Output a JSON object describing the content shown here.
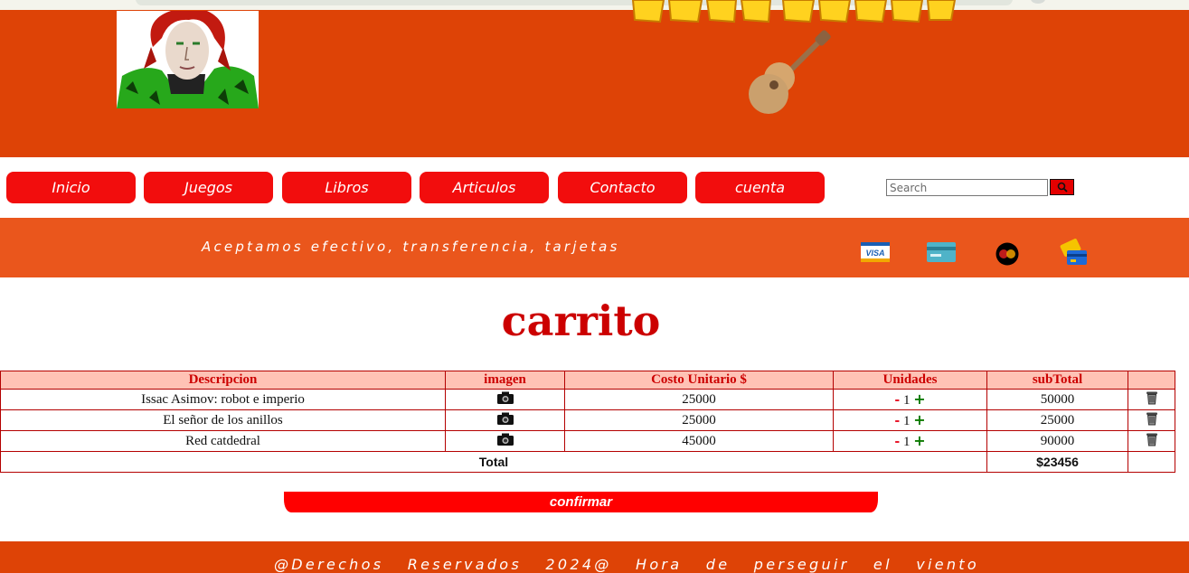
{
  "header": {
    "avatar_icon": "character-portrait-image",
    "logo_icon": "site-logo-wordmark",
    "guitar_icon": "guitar-icon",
    "colors": {
      "background": "#de4306",
      "logo": "#ffd21f"
    }
  },
  "nav": {
    "items": [
      {
        "label": "Inicio"
      },
      {
        "label": "Juegos"
      },
      {
        "label": "Libros"
      },
      {
        "label": "Articulos"
      },
      {
        "label": "Contacto"
      },
      {
        "label": "cuenta"
      }
    ],
    "search": {
      "placeholder": "Search",
      "button_icon": "search-icon"
    },
    "colors": {
      "button": "#f20d0d"
    }
  },
  "payments": {
    "text": "Aceptamos efectivo, transferencia, tarjetas",
    "icons": [
      "visa-card-icon",
      "credit-card-icon",
      "mastercard-icon",
      "card-payment-icon"
    ],
    "colors": {
      "background": "#ea561c"
    }
  },
  "cart": {
    "title": "carrito",
    "columns": [
      "Descripcion",
      "imagen",
      "Costo Unitario $",
      "Unidades",
      "subTotal",
      ""
    ],
    "rows": [
      {
        "description": "Issac Asimov: robot e imperio",
        "image_icon": "camera-icon",
        "unit_cost": "25000",
        "minus": "-",
        "qty": "1",
        "plus": "+",
        "subtotal": "50000",
        "delete_icon": "trash-icon"
      },
      {
        "description": "El señor de los anillos",
        "image_icon": "camera-icon",
        "unit_cost": "25000",
        "minus": "-",
        "qty": "1",
        "plus": "+",
        "subtotal": "25000",
        "delete_icon": "trash-icon"
      },
      {
        "description": "Red catdedral",
        "image_icon": "camera-icon",
        "unit_cost": "45000",
        "minus": "-",
        "qty": "1",
        "plus": "+",
        "subtotal": "90000",
        "delete_icon": "trash-icon"
      }
    ],
    "total_label": "Total",
    "total_value": "$23456",
    "confirm_label": "confirmar",
    "colors": {
      "accent": "#cc0000",
      "header_bg": "#ffc2b5",
      "total_bg": "#ffc8c0",
      "confirm": "#ff0000"
    }
  },
  "footer": {
    "text": "@Derechos Reservados 2024@ Hora de perseguir el viento"
  }
}
